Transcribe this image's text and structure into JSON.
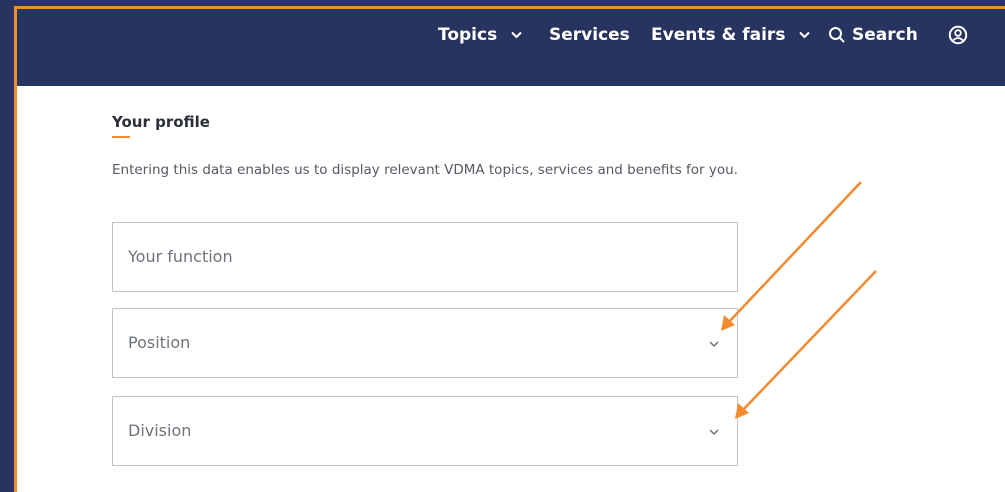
{
  "nav": {
    "items": [
      {
        "label": "Topics",
        "has_dropdown": true
      },
      {
        "label": "Services",
        "has_dropdown": false
      },
      {
        "label": "Events & fairs",
        "has_dropdown": true
      }
    ],
    "search_label": "Search",
    "search_icon": "search-icon",
    "account_icon": "user-account-icon"
  },
  "profile": {
    "title": "Your profile",
    "description": "Entering this data enables us to display relevant VDMA topics, services and benefits for you.",
    "fields": {
      "function_placeholder": "Your function",
      "position_placeholder": "Position",
      "division_placeholder": "Division"
    }
  },
  "colors": {
    "nav_bg": "#27345f",
    "accent": "#f28a2e",
    "text": "#2b2f3a"
  }
}
